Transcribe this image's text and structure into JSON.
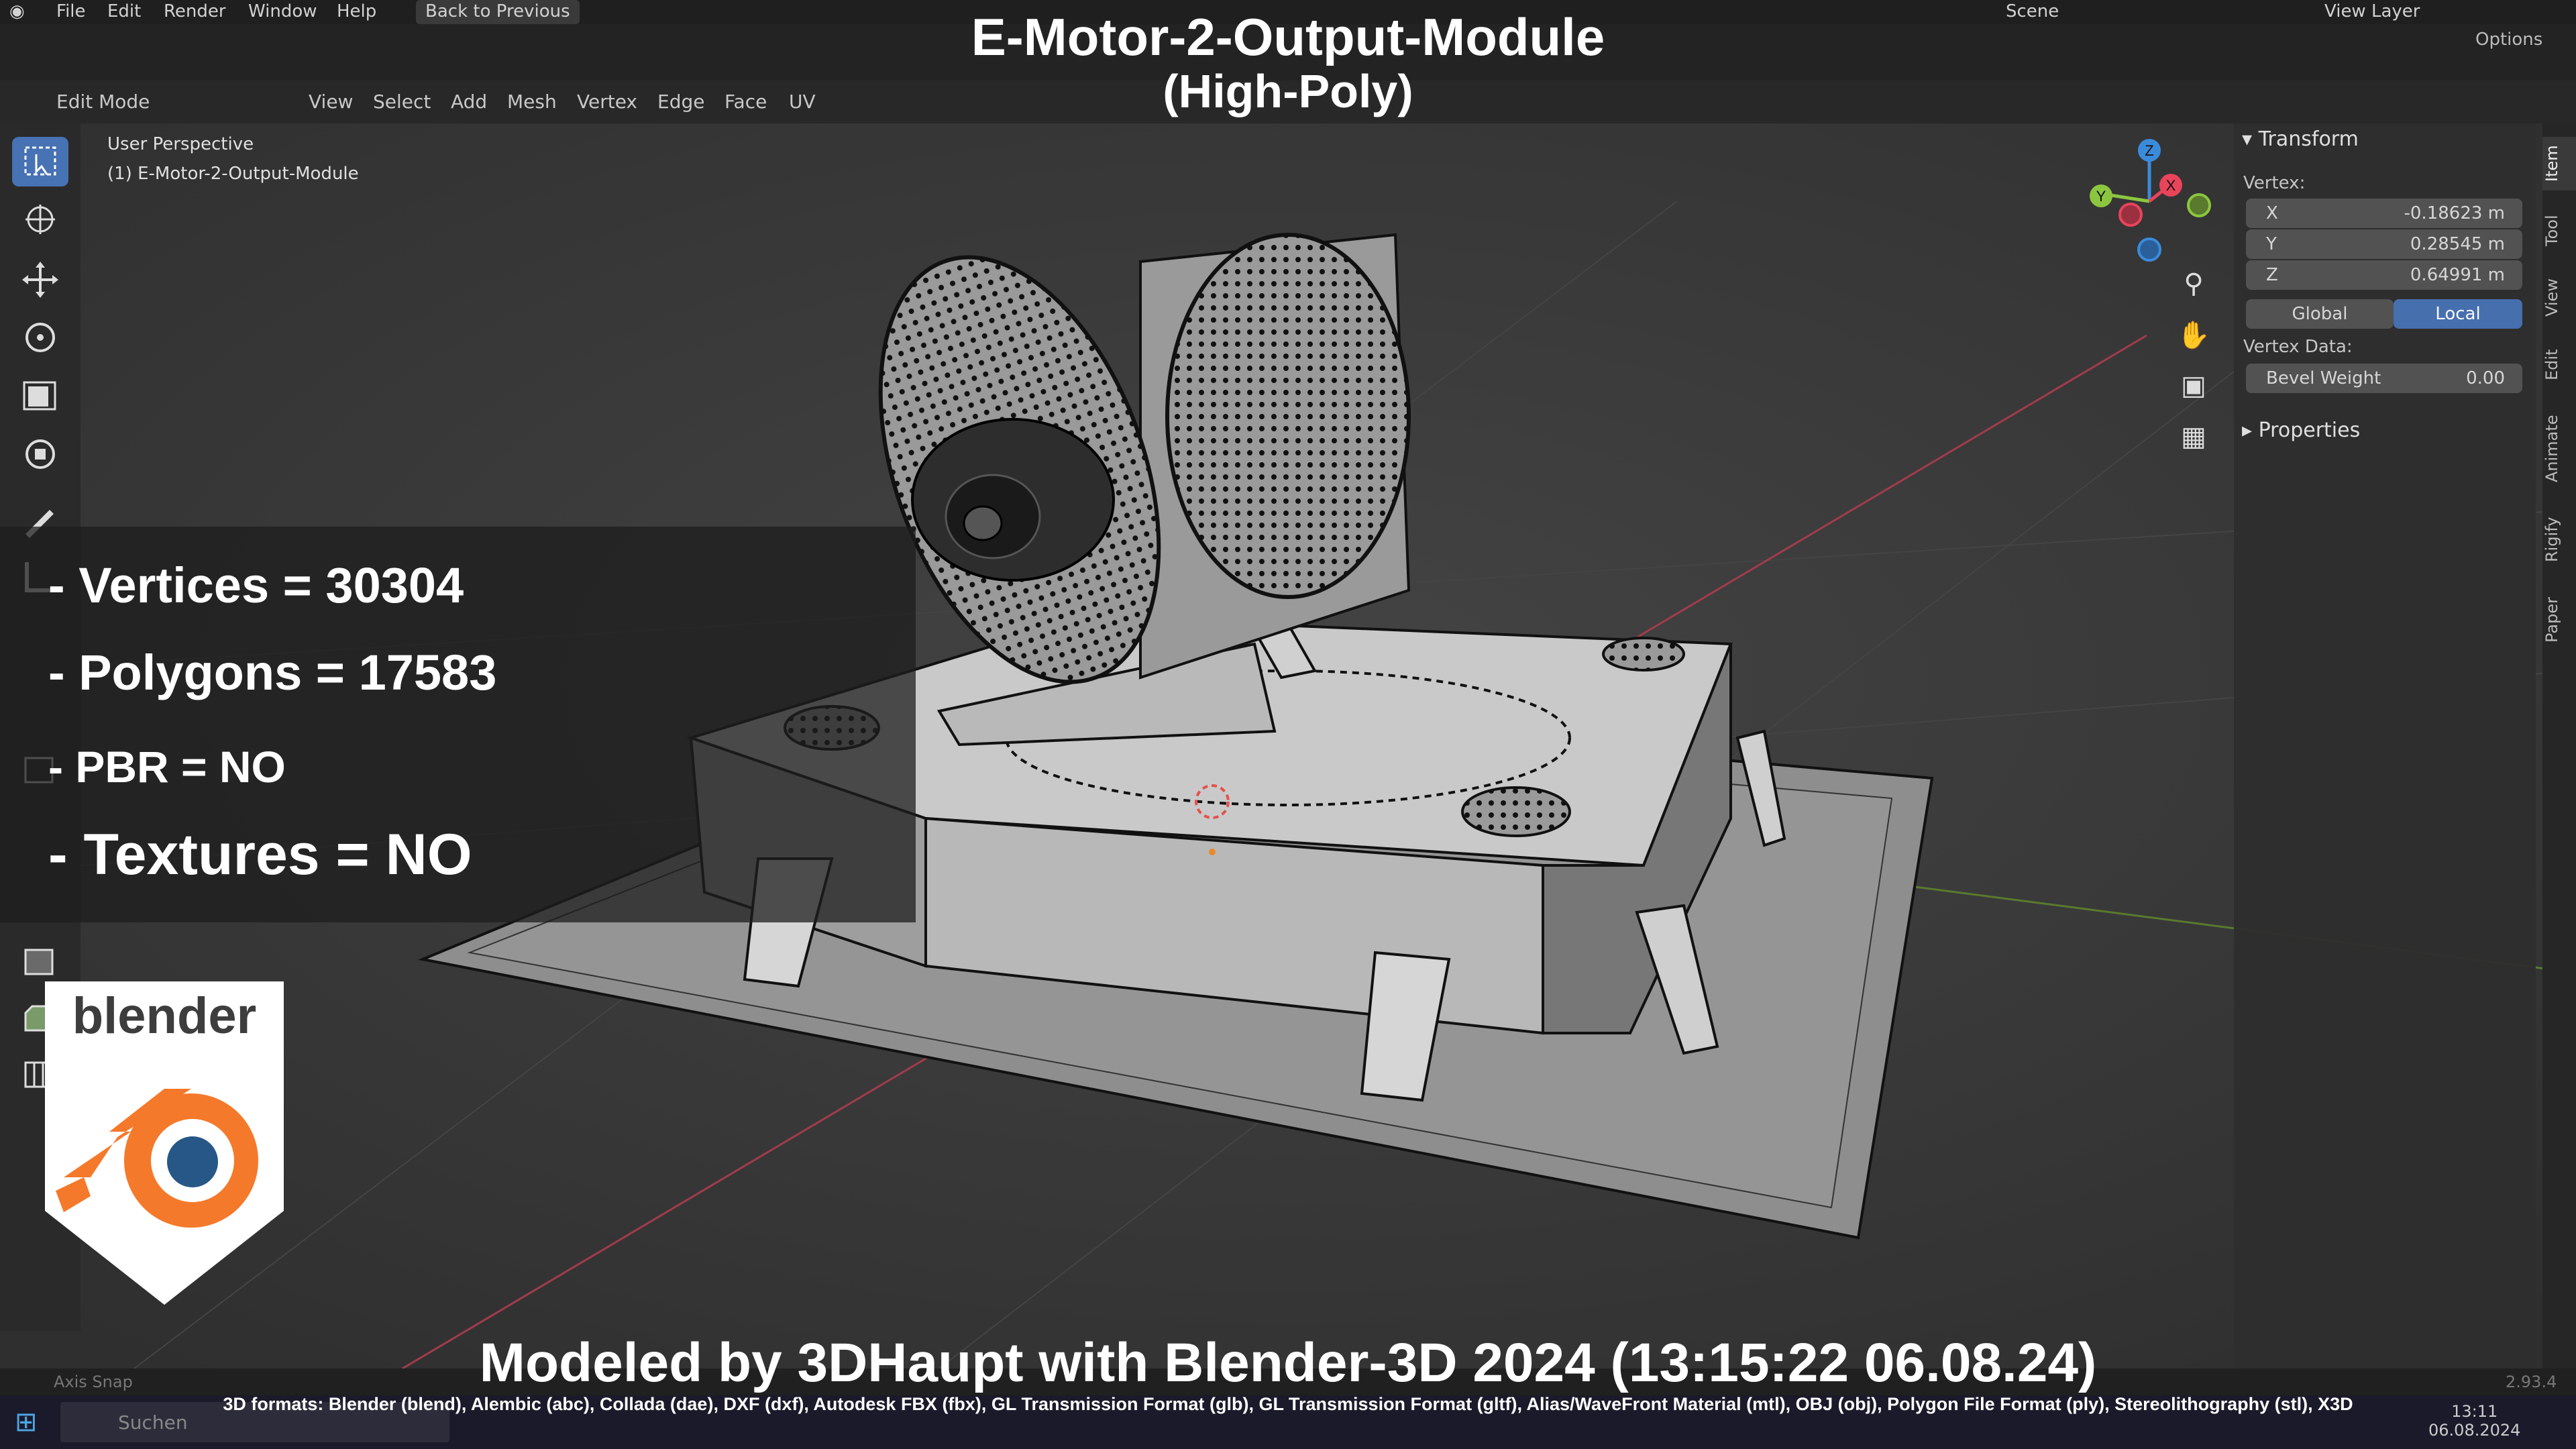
{
  "menu": {
    "items": [
      "File",
      "Edit",
      "Render",
      "Window",
      "Help"
    ],
    "back_button": "Back to Previous",
    "scene_label": "Scene",
    "view_layer_label": "View Layer",
    "options_label": "Options"
  },
  "header": {
    "mode": "Edit Mode",
    "items": [
      "View",
      "Select",
      "Add",
      "Mesh",
      "Vertex",
      "Edge",
      "Face",
      "UV"
    ]
  },
  "viewport": {
    "perspective": "User Perspective",
    "object_name": "(1) E-Motor-2-Output-Module"
  },
  "gizmo": {
    "z": "Z",
    "y": "Y",
    "x": "X"
  },
  "npanel": {
    "transform_title": "Transform",
    "vertex_label": "Vertex:",
    "x_label": "X",
    "x_value": "-0.18623 m",
    "y_label": "Y",
    "y_value": "0.28545 m",
    "z_label": "Z",
    "z_value": "0.64991 m",
    "global_label": "Global",
    "local_label": "Local",
    "vertex_data_label": "Vertex Data:",
    "bevel_label": "Bevel Weight",
    "bevel_value": "0.00",
    "properties_title": "Properties",
    "tabs": [
      "Item",
      "Tool",
      "View",
      "Edit",
      "Animate",
      "Rigify",
      "Paper"
    ]
  },
  "overlay": {
    "title_line1": "E-Motor-2-Output-Module",
    "title_line2": "(High-Poly)",
    "vertices": "- Vertices = 30304",
    "polygons": "- Polygons = 17583",
    "pbr": "- PBR =  NO",
    "textures": "- Textures = NO",
    "credit": "Modeled by 3DHaupt with Blender-3D 2024 (13:15:22  06.08.24)",
    "formats": "3D formats: Blender (blend), Alembic (abc), Collada (dae), DXF (dxf), Autodesk FBX (fbx), GL Transmission Format (glb), GL Transmission Format (gltf), Alias/WaveFront Material (mtl), OBJ (obj), Polygon File Format (ply), Stereolithography (stl), X3D",
    "logo_text": "blender"
  },
  "status": {
    "left": "Axis Snap",
    "version": "2.93.4",
    "search_placeholder": "Suchen",
    "clock_time": "13:11",
    "clock_date": "06.08.2024"
  },
  "colors": {
    "blender_orange": "#f5792a",
    "blender_blue": "#265787",
    "accent_blue": "#4772b3",
    "x_axis": "#e8445a",
    "y_axis": "#8cc63f",
    "z_axis": "#3b8bdb"
  }
}
